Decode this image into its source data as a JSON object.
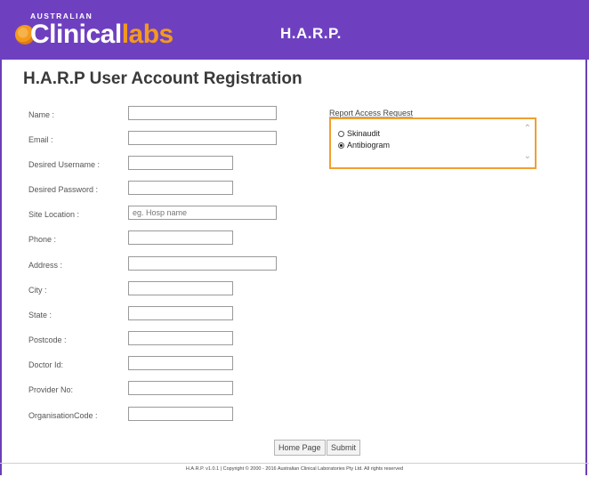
{
  "header": {
    "logo_top": "AUSTRALIAN",
    "logo_word_a": "Clinical",
    "logo_word_b": "labs",
    "title": "H.A.R.P."
  },
  "page": {
    "title": "H.A.R.P User Account Registration"
  },
  "form": {
    "fields": [
      {
        "label": "Name :",
        "value": "",
        "placeholder": ""
      },
      {
        "label": "Email :",
        "value": "",
        "placeholder": ""
      },
      {
        "label": "Desired Username :",
        "value": "",
        "placeholder": ""
      },
      {
        "label": "Desired Password :",
        "value": "",
        "placeholder": ""
      },
      {
        "label": "Site Location :",
        "value": "",
        "placeholder": "eg. Hosp name"
      },
      {
        "label": "Phone :",
        "value": "",
        "placeholder": ""
      },
      {
        "label": "Address :",
        "value": "",
        "placeholder": ""
      },
      {
        "label": "City :",
        "value": "",
        "placeholder": ""
      },
      {
        "label": "State :",
        "value": "",
        "placeholder": ""
      },
      {
        "label": "Postcode :",
        "value": "",
        "placeholder": ""
      },
      {
        "label": "Doctor Id:",
        "value": "",
        "placeholder": ""
      },
      {
        "label": "Provider No:",
        "value": "",
        "placeholder": ""
      },
      {
        "label": "OrganisationCode :",
        "value": "",
        "placeholder": ""
      }
    ]
  },
  "report_access": {
    "label": "Report Access Request",
    "options": [
      {
        "label": "Skinaudit",
        "selected": false
      },
      {
        "label": "Antibiogram",
        "selected": true
      }
    ]
  },
  "buttons": {
    "home": "Home Page",
    "submit": "Submit"
  },
  "footer": {
    "text": "H.A.R.P. v1.0.1 | Copyright © 2000 - 2016 Australian Clinical Laboratories Pty Ltd. All rights reserved"
  },
  "colors": {
    "header_bg": "#6e40c0",
    "brand_orange": "#f39a1e",
    "focus_border": "#f0a030"
  },
  "icons": {
    "logo": "swirl-logo-icon",
    "scroll_up": "chevron-up-icon",
    "scroll_down": "chevron-down-icon"
  }
}
